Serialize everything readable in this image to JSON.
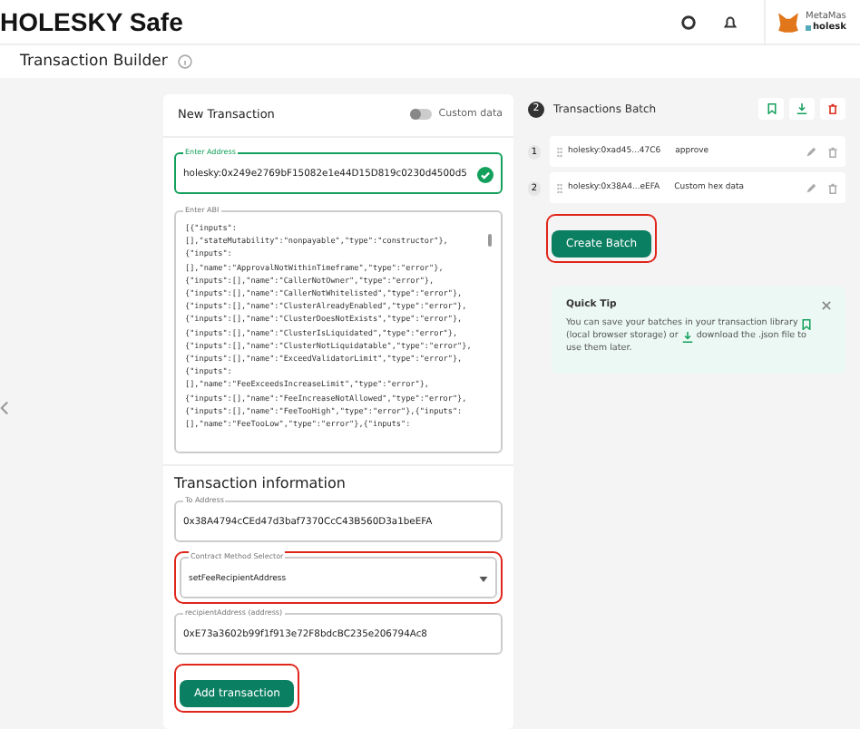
{
  "app_title": "HOLESKY Safe",
  "wallet": {
    "name": "MetaMas",
    "network": "holesk"
  },
  "page_title": "Transaction Builder",
  "new_transaction": {
    "title": "New Transaction",
    "custom_data": {
      "label": "Custom data",
      "on": false
    },
    "address": {
      "label": "Enter Address",
      "value": "holesky:0x249e2769bF15082e1e44D15D819c0230d4500d5",
      "valid": true
    },
    "abi": {
      "label": "Enter ABI",
      "lines": [
        "[{\"inputs\":",
        "[],\"stateMutability\":\"nonpayable\",\"type\":\"constructor\"},",
        "{\"inputs\":",
        "[],\"name\":\"ApprovalNotWithinTimeframe\",\"type\":\"error\"},",
        "{\"inputs\":[],\"name\":\"CallerNotOwner\",\"type\":\"error\"},",
        "{\"inputs\":[],\"name\":\"CallerNotWhitelisted\",\"type\":\"error\"},",
        "{\"inputs\":[],\"name\":\"ClusterAlreadyEnabled\",\"type\":\"error\"},",
        "{\"inputs\":[],\"name\":\"ClusterDoesNotExists\",\"type\":\"error\"},",
        "{\"inputs\":[],\"name\":\"ClusterIsLiquidated\",\"type\":\"error\"},",
        "{\"inputs\":[],\"name\":\"ClusterNotLiquidatable\",\"type\":\"error\"},",
        "{\"inputs\":[],\"name\":\"ExceedValidatorLimit\",\"type\":\"error\"},",
        "{\"inputs\":",
        "[],\"name\":\"FeeExceedsIncreaseLimit\",\"type\":\"error\"},",
        "{\"inputs\":[],\"name\":\"FeeIncreaseNotAllowed\",\"type\":\"error\"},",
        "{\"inputs\":[],\"name\":\"FeeTooHigh\",\"type\":\"error\"},{\"inputs\":",
        "[],\"name\":\"FeeTooLow\",\"type\":\"error\"},{\"inputs\":"
      ]
    }
  },
  "transaction_information": {
    "title": "Transaction information",
    "to_address": {
      "label": "To Address",
      "value": "0x38A4794cCEd47d3baf7370CcC43B560D3a1beEFA"
    },
    "method_selector": {
      "label": "Contract Method Selector",
      "value": "setFeeRecipientAddress",
      "highlighted": true
    },
    "recipient": {
      "label": "recipientAddress (address)",
      "value": "0xE73a3602b99f1f913e72F8bdcBC235e206794Ac8"
    },
    "add_button": {
      "label": "Add transaction",
      "highlighted": true
    }
  },
  "batch": {
    "count": "2",
    "title": "Transactions Batch",
    "rows": [
      {
        "index": "1",
        "address": "holesky:0xad45...47C6",
        "method": "approve"
      },
      {
        "index": "2",
        "address": "holesky:0x38A4...eEFA",
        "method": "Custom hex data"
      }
    ],
    "create_button": {
      "label": "Create Batch",
      "highlighted": true
    }
  },
  "quick_tip": {
    "title": "Quick Tip",
    "text_1": "You can save your batches in your transaction library",
    "text_2": "(local browser storage) or",
    "text_3": "download the .json file to",
    "text_4": "use them later."
  }
}
